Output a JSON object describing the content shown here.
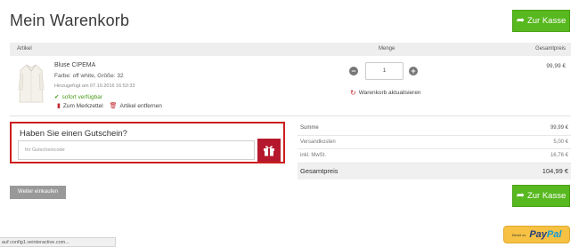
{
  "page": {
    "title": "Mein Warenkorb"
  },
  "checkout": {
    "label": "Zur Kasse"
  },
  "table": {
    "col_article": "Artikel",
    "col_quantity": "Menge",
    "col_total": "Gesamtpreis"
  },
  "item": {
    "name": "Bluse CIPEMA",
    "attributes": "Farbe: off white, Größe: 32",
    "added": "Hinzugefügt am 07.10.2016 16:53:33",
    "availability": "sofort verfügbar",
    "wishlist": "Zum Merkzettel",
    "remove": "Artikel entfernen",
    "quantity": "1",
    "price": "99,99 €"
  },
  "cart": {
    "update_label": "Warenkorb aktualisieren"
  },
  "voucher": {
    "title": "Haben Sie einen Gutschein?",
    "placeholder": "Ihr Gutscheincode"
  },
  "summary": {
    "rows": [
      {
        "label": "Summe",
        "value": "99,99 €"
      },
      {
        "label": "Versandkosten",
        "value": "5,00 €"
      },
      {
        "label": "inkl. MwSt.",
        "value": "16,76 €"
      },
      {
        "label": "Gesamtpreis",
        "value": "104,99 €"
      }
    ]
  },
  "continue": {
    "label": "Weiter einkaufen"
  },
  "paypal": {
    "prefix": "Direkt zu",
    "brand_a": "Pay",
    "brand_b": "Pal"
  },
  "status": {
    "text": "auf config1.veinteractive.com..."
  },
  "colors": {
    "accent_green": "#58b81f",
    "voucher_border": "#cc1f1f",
    "gift_button": "#b5182c",
    "paypal_yellow": "#f7c244"
  },
  "icons": [
    "arrow-right-icon",
    "check-icon",
    "bookmark-icon",
    "trash-icon",
    "minus-icon",
    "plus-icon",
    "refresh-icon",
    "gift-icon"
  ]
}
